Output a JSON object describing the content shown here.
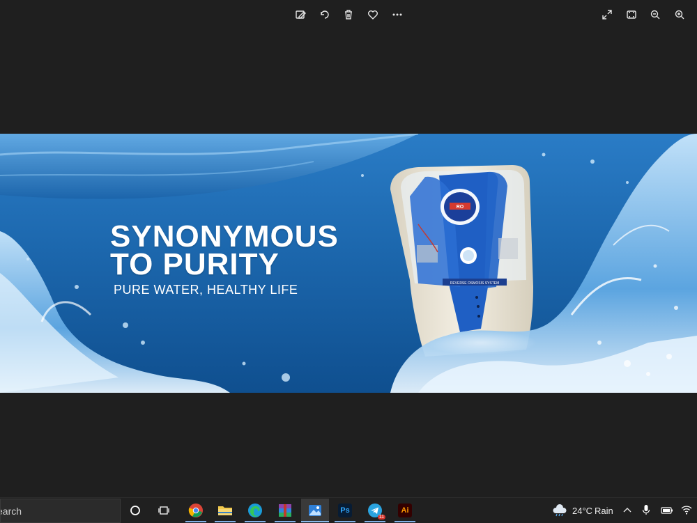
{
  "toolbar": {
    "left_icons": [
      "edit-image-icon",
      "rotate-icon",
      "delete-icon",
      "favorite-heart-icon",
      "more-options-icon"
    ],
    "right_icons": [
      "expand-icon",
      "fit-to-window-icon",
      "zoom-out-icon",
      "zoom-in-icon"
    ]
  },
  "image": {
    "headline_line1": "SYNONYMOUS",
    "headline_line2": "TO PURITY",
    "tagline": "PURE WATER, HEALTHY LIFE",
    "product_plate": "REVERSE OSMOSIS SYSTEM",
    "product_badge": "RO",
    "brand_colors": {
      "water_blue": "#1d6fb8",
      "deep_blue": "#0c4a86",
      "product_blue": "#1f5fc4",
      "cream": "#efe9d9"
    }
  },
  "taskbar": {
    "search_text": "earch",
    "apps": [
      {
        "name": "cortana",
        "icon": "cortana-circle-icon"
      },
      {
        "name": "task-view",
        "icon": "task-view-icon"
      },
      {
        "name": "chrome",
        "icon": "chrome-icon"
      },
      {
        "name": "file-explorer",
        "icon": "folder-icon"
      },
      {
        "name": "edge",
        "icon": "edge-icon"
      },
      {
        "name": "winrar",
        "icon": "winrar-icon"
      },
      {
        "name": "photos",
        "icon": "photos-icon",
        "active": true
      },
      {
        "name": "photoshop",
        "icon": "photoshop-icon",
        "label": "Ps"
      },
      {
        "name": "telegram",
        "icon": "telegram-icon",
        "badge": "11"
      },
      {
        "name": "illustrator",
        "icon": "illustrator-icon",
        "label": "Ai"
      }
    ],
    "tray": {
      "weather_temp": "24°C",
      "weather_text": "Rain",
      "icons": [
        "weather-rain-cloud-icon",
        "chevron-up-icon",
        "microphone-icon",
        "battery-icon",
        "wifi-icon"
      ]
    }
  }
}
